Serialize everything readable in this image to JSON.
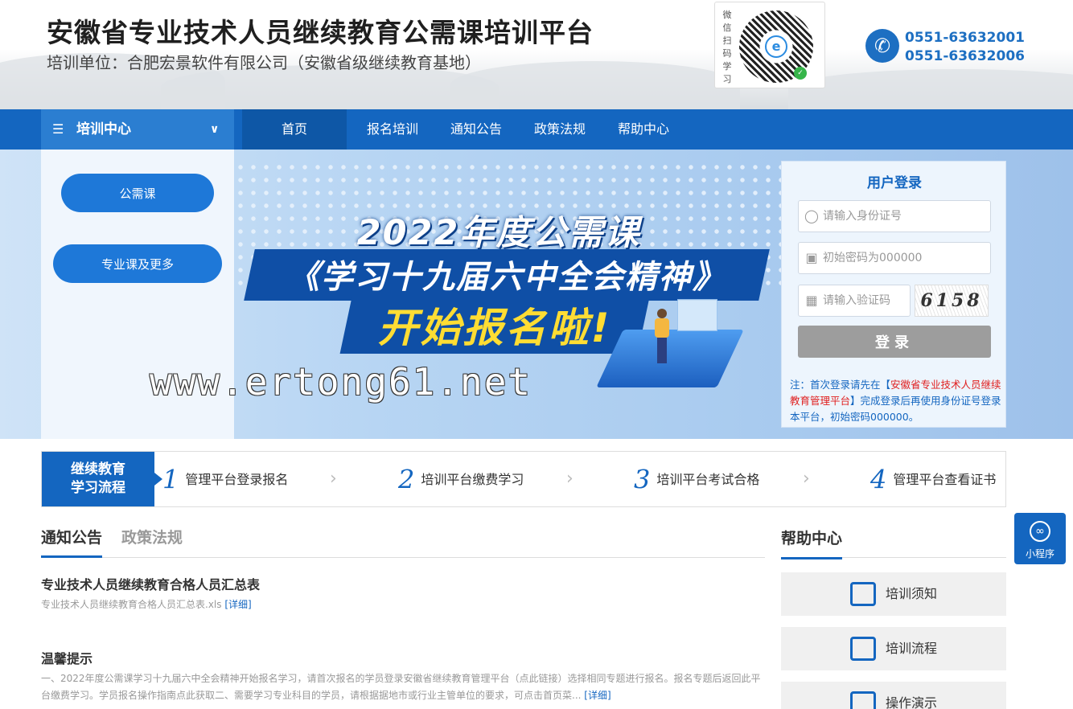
{
  "header": {
    "title": "安徽省专业技术人员继续教育公需课培训平台",
    "subtitle": "培训单位：合肥宏景软件有限公司（安徽省级继续教育基地）",
    "qr_label": [
      "微",
      "信",
      "扫",
      "码",
      "学",
      "习"
    ],
    "phones": [
      "0551-63632001",
      "0551-63632006"
    ]
  },
  "nav": {
    "category": "培训中心",
    "items": [
      "首页",
      "报名培训",
      "通知公告",
      "政策法规",
      "帮助中心"
    ],
    "active": "首页"
  },
  "sidebar": {
    "buttons": [
      "公需课",
      "专业课及更多"
    ]
  },
  "banner": {
    "line1": "2022年度公需课",
    "line2": "《学习十九届六中全会精神》",
    "line3": "开始报名啦!",
    "watermark": "www.ertong61.net"
  },
  "login": {
    "title": "用户登录",
    "id_placeholder": "请输入身份证号",
    "password_placeholder": "初始密码为000000",
    "captcha_placeholder": "请输入验证码",
    "captcha_code": "6158",
    "button": "登录",
    "note_prefix": "注：首次登录请先在【",
    "note_link": "安徽省专业技术人员继续教育管理平台",
    "note_suffix": "】完成登录后再使用身份证号登录本平台，初始密码000000。"
  },
  "process": {
    "title_line1": "继续教育",
    "title_line2": "学习流程",
    "steps": [
      {
        "num": "1",
        "text": "管理平台登录报名"
      },
      {
        "num": "2",
        "text": "培训平台缴费学习"
      },
      {
        "num": "3",
        "text": "培训平台考试合格"
      },
      {
        "num": "4",
        "text": "管理平台查看证书"
      }
    ]
  },
  "tabs": [
    "通知公告",
    "政策法规"
  ],
  "news": [
    {
      "title": "专业技术人员继续教育合格人员汇总表",
      "desc": "专业技术人员继续教育合格人员汇总表.xls",
      "more": "[详细]"
    },
    {
      "title": "温馨提示",
      "desc": "一、2022年度公需课学习十九届六中全会精神开始报名学习，请首次报名的学员登录安徽省继续教育管理平台（点此链接）选择相同专题进行报名。报名专题后返回此平台缴费学习。学员报名操作指南点此获取二、需要学习专业科目的学员，请根据据地市或行业主管单位的要求，可点击首页菜...",
      "more": "[详细]"
    }
  ],
  "help": {
    "title": "帮助中心",
    "items": [
      "培训须知",
      "培训流程",
      "操作演示"
    ]
  },
  "mini_program": "小程序",
  "colors": {
    "primary": "#1466c0",
    "nav_active": "#0e57a6",
    "login_button": "#9d9d9d"
  }
}
